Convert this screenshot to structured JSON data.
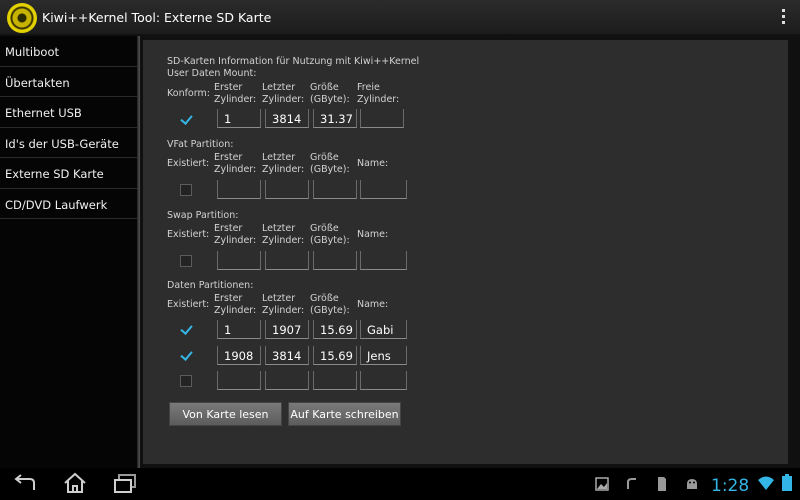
{
  "app": {
    "title": "Kiwi++Kernel Tool: Externe SD Karte",
    "icon": "kiwi-logo-icon"
  },
  "sidebar": {
    "items": [
      {
        "label": "Multiboot"
      },
      {
        "label": "Übertakten"
      },
      {
        "label": "Ethernet USB"
      },
      {
        "label": "Id's der USB-Geräte"
      },
      {
        "label": "Externe SD Karte"
      },
      {
        "label": "CD/DVD Laufwerk"
      }
    ]
  },
  "info": {
    "line1": "SD-Karten Information für Nutzung mit Kiwi++Kernel",
    "line2": "User Daten Mount:"
  },
  "user_mount": {
    "konform_label": "Konform:",
    "headers": {
      "first": "Erster Zylinder:",
      "last": "Letzter Zylinder:",
      "size": "Größe (GByte):",
      "free": "Freie Zylinder:"
    },
    "checked": true,
    "values": {
      "first": "1",
      "last": "3814",
      "size": "31.37",
      "free": ""
    }
  },
  "vfat": {
    "title": "VFat Partition:",
    "exists_label": "Existiert:",
    "headers": {
      "first": "Erster Zylinder:",
      "last": "Letzter Zylinder:",
      "size": "Größe (GByte):",
      "name": "Name:"
    },
    "checked": false
  },
  "swap": {
    "title": "Swap Partition:",
    "exists_label": "Existiert:",
    "headers": {
      "first": "Erster Zylinder:",
      "last": "Letzter Zylinder:",
      "size": "Größe (GByte):",
      "name": "Name:"
    },
    "checked": false
  },
  "data_partitions": {
    "title": "Daten Partitionen:",
    "exists_label": "Existiert:",
    "headers": {
      "first": "Erster Zylinder:",
      "last": "Letzter Zylinder:",
      "size": "Größe (GByte):",
      "name": "Name:"
    },
    "rows": [
      {
        "checked": true,
        "first": "1",
        "last": "1907",
        "size": "15.69",
        "name": "Gabi"
      },
      {
        "checked": true,
        "first": "1908",
        "last": "3814",
        "size": "15.69",
        "name": "Jens"
      },
      {
        "checked": false,
        "first": "",
        "last": "",
        "size": "",
        "name": ""
      }
    ]
  },
  "buttons": {
    "read": "Von Karte lesen",
    "write": "Auf Karte schreiben"
  },
  "statusbar": {
    "time": "1:28"
  },
  "colors": {
    "accent": "#33b5e5",
    "panel": "#2d2d2d",
    "actionbar": "#1c1c1c"
  }
}
